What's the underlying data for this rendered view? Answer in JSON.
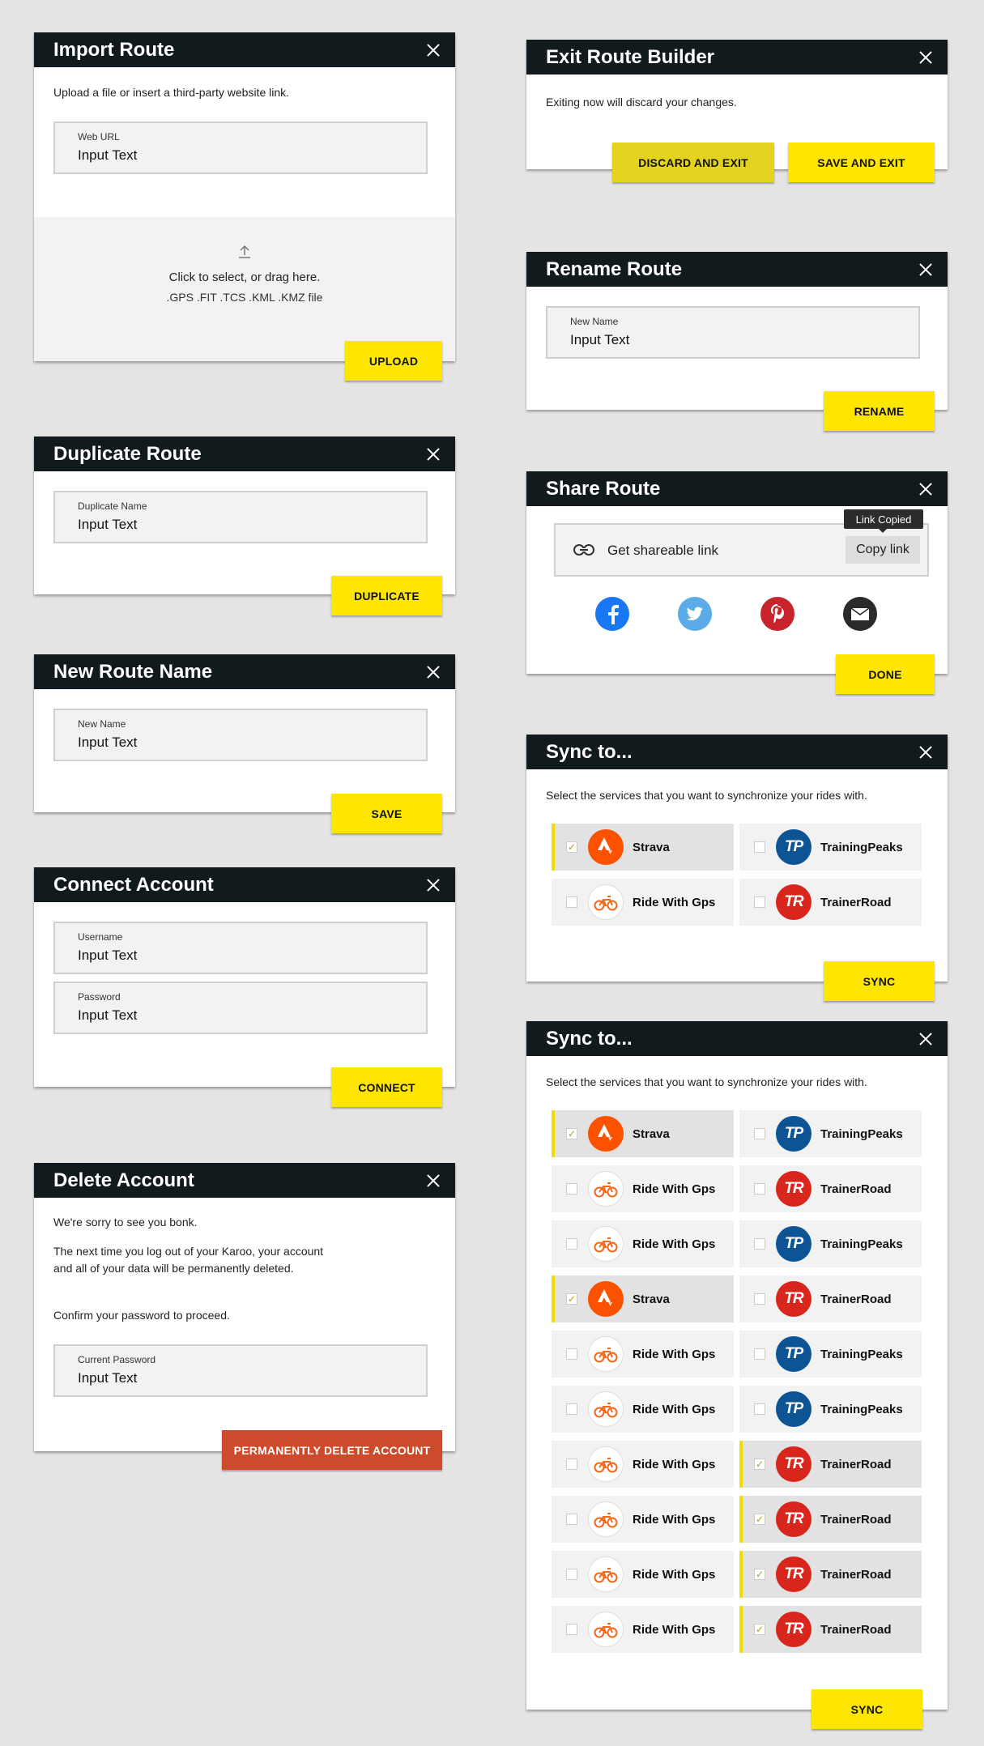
{
  "import_route": {
    "title": "Import Route",
    "description": "Upload a file or insert a third-party website link.",
    "field_label": "Web URL",
    "field_value": "Input Text",
    "drop_text": "Click to select, or drag here.",
    "file_types": ".GPS .FIT .TCS .KML .KMZ file",
    "upload_label": "UPLOAD"
  },
  "duplicate_route": {
    "title": "Duplicate Route",
    "field_label": "Duplicate Name",
    "field_value": "Input Text",
    "button_label": "DUPLICATE"
  },
  "new_route_name": {
    "title": "New Route Name",
    "field_label": "New Name",
    "field_value": "Input Text",
    "button_label": "SAVE"
  },
  "connect_account": {
    "title": "Connect Account",
    "username_label": "Username",
    "username_value": "Input Text",
    "password_label": "Password",
    "password_value": "Input Text",
    "button_label": "CONNECT"
  },
  "delete_account": {
    "title": "Delete Account",
    "line1": "We're sorry to see you bonk.",
    "line2": "The next time you log out of your Karoo,  your account and all of your data will be permanently deleted.",
    "line3": "Confirm your password to proceed.",
    "field_label": "Current Password",
    "field_value": "Input Text",
    "button_label": "PERMANENTLY DELETE ACCOUNT",
    "button_color": "#cc4b2c"
  },
  "exit_builder": {
    "title": "Exit Route Builder",
    "description": "Exiting now will discard your changes.",
    "discard_label": "DISCARD AND EXIT",
    "save_label": "SAVE AND EXIT",
    "discard_color": "#e3d31f"
  },
  "rename_route": {
    "title": "Rename Route",
    "field_label": "New Name",
    "field_value": "Input Text",
    "button_label": "RENAME"
  },
  "share_route": {
    "title": "Share Route",
    "link_text": "Get shareable link",
    "copy_label": "Copy link",
    "tooltip": "Link Copied",
    "social": [
      "facebook-icon",
      "twitter-icon",
      "pinterest-icon",
      "email-icon"
    ],
    "done_label": "DONE"
  },
  "sync_small": {
    "title": "Sync to...",
    "description": "Select the services that you want to synchronize your rides with.",
    "button_label": "SYNC",
    "services": [
      {
        "name": "Strava",
        "logo": "strava",
        "checked": true
      },
      {
        "name": "TrainingPeaks",
        "logo": "tp",
        "checked": false
      },
      {
        "name": "Ride With Gps",
        "logo": "rwg",
        "checked": false
      },
      {
        "name": "TrainerRoad",
        "logo": "tr",
        "checked": false
      }
    ]
  },
  "sync_large": {
    "title": "Sync to...",
    "description": "Select the services that you want to synchronize your rides with.",
    "button_label": "SYNC",
    "services": [
      {
        "name": "Strava",
        "logo": "strava",
        "checked": true
      },
      {
        "name": "TrainingPeaks",
        "logo": "tp",
        "checked": false
      },
      {
        "name": "Ride With Gps",
        "logo": "rwg",
        "checked": false
      },
      {
        "name": "TrainerRoad",
        "logo": "tr",
        "checked": false
      },
      {
        "name": "Ride With Gps",
        "logo": "rwg",
        "checked": false
      },
      {
        "name": "TrainingPeaks",
        "logo": "tp",
        "checked": false
      },
      {
        "name": "Strava",
        "logo": "strava",
        "checked": true
      },
      {
        "name": "TrainerRoad",
        "logo": "tr",
        "checked": false
      },
      {
        "name": "Ride With Gps",
        "logo": "rwg",
        "checked": false
      },
      {
        "name": "TrainingPeaks",
        "logo": "tp",
        "checked": false
      },
      {
        "name": "Ride With Gps",
        "logo": "rwg",
        "checked": false
      },
      {
        "name": "TrainingPeaks",
        "logo": "tp",
        "checked": false
      },
      {
        "name": "Ride With Gps",
        "logo": "rwg",
        "checked": false
      },
      {
        "name": "TrainerRoad",
        "logo": "tr",
        "checked": true
      },
      {
        "name": "Ride With Gps",
        "logo": "rwg",
        "checked": false
      },
      {
        "name": "TrainerRoad",
        "logo": "tr",
        "checked": true
      },
      {
        "name": "Ride With Gps",
        "logo": "rwg",
        "checked": false
      },
      {
        "name": "TrainerRoad",
        "logo": "tr",
        "checked": true
      },
      {
        "name": "Ride With Gps",
        "logo": "rwg",
        "checked": false
      },
      {
        "name": "TrainerRoad",
        "logo": "tr",
        "checked": true
      }
    ]
  },
  "colors": {
    "header": "#111a1d",
    "accent": "#ffe600",
    "background": "#e4e4e4"
  }
}
